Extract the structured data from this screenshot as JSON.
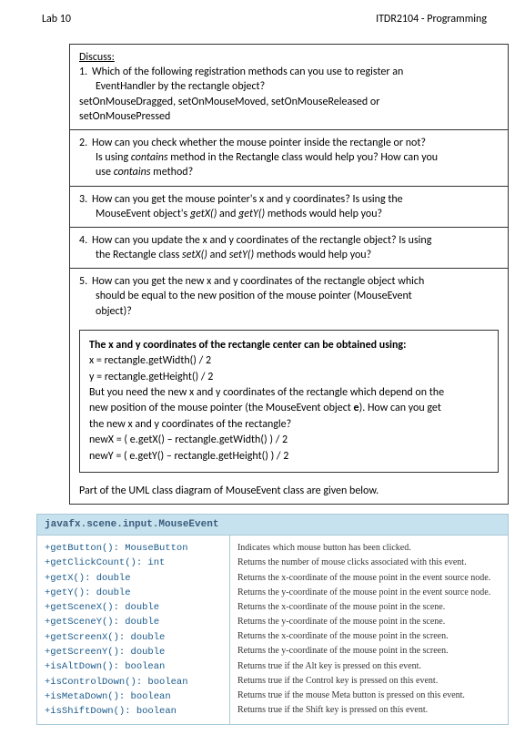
{
  "header": {
    "left": "Lab 10",
    "right": "ITDR2104 - Programming"
  },
  "discuss_title": "Discuss:",
  "q1": {
    "num": "1.",
    "line1": "Which of the following registration methods can you use to register an",
    "line2": "EventHandler by the rectangle object?",
    "mono1": "setOnMouseDragged, setOnMouseMoved, setOnMouseReleased or",
    "mono2": "setOnMousePressed"
  },
  "q2": {
    "num": "2.",
    "line1": "How can you check whether the mouse pointer inside the rectangle or not?",
    "line2_a": "Is using ",
    "line2_i": "contains",
    "line2_b": " method in the Rectangle class would help you? How can you",
    "line3_a": "use ",
    "line3_i": "contains",
    "line3_b": " method?"
  },
  "q3": {
    "num": "3.",
    "line1": "How can you get the mouse pointer's x and y coordinates? Is using the",
    "line2_a": "MouseEvent object's ",
    "line2_i1": "getX()",
    "line2_b": " and ",
    "line2_i2": "getY()",
    "line2_c": " methods would help you?"
  },
  "q4": {
    "num": "4.",
    "line1": "How can you update the x and y coordinates of the rectangle object? Is using",
    "line2_a": "the Rectangle class ",
    "line2_i1": "setX()",
    "line2_b": " and ",
    "line2_i2": "setY()",
    "line2_c": " methods would help you?"
  },
  "q5": {
    "num": "5.",
    "line1": "How can you get the new x and y coordinates of the rectangle object which",
    "line2": "should be equal to the new position of the mouse pointer (MouseEvent",
    "line3": "object)?"
  },
  "box": {
    "b1": "The x and y coordinates of the rectangle center can be obtained using:",
    "l1": "x = rectangle.getWidth() / 2",
    "l2": "y = rectangle.getHeight() / 2",
    "l3": "But you need the new x and y coordinates of the rectangle which depend on the",
    "l4_a": "new position of the mouse pointer (the MouseEvent object ",
    "l4_b": "e",
    "l4_c": "). How can you get",
    "l5": "the new x and y coordinates of the rectangle?",
    "l6": "newX = ( e.getX() – rectangle.getWidth() ) / 2",
    "l7": "newY = ( e.getY() – rectangle.getHeight() ) / 2"
  },
  "uml_caption": "Part of the UML class diagram of MouseEvent class are given below.",
  "uml_title": "javafx.scene.input.MouseEvent",
  "uml_methods": [
    "+getButton(): MouseButton",
    "+getClickCount(): int",
    "+getX(): double",
    "+getY(): double",
    "+getSceneX(): double",
    "+getSceneY(): double",
    "+getScreenX(): double",
    "+getScreenY(): double",
    "+isAltDown(): boolean",
    "+isControlDown(): boolean",
    "+isMetaDown(): boolean",
    "+isShiftDown(): boolean"
  ],
  "uml_desc": [
    "Indicates which mouse button has been clicked.",
    "Returns the number of mouse clicks associated with this event.",
    "Returns the x-coordinate of the mouse point in the event source node.",
    "Returns the y-coordinate of the mouse point in the event source node.",
    "Returns the x-coordinate of the mouse point in the scene.",
    "Returns the y-coordinate of the mouse point in the scene.",
    "Returns the x-coordinate of the mouse point in the screen.",
    "Returns the y-coordinate of the mouse point in the screen.",
    "Returns true if the Alt key is pressed on this event.",
    "Returns true if the Control key is pressed on this event.",
    "Returns true if the mouse Meta button is pressed on this event.",
    "Returns true if the Shift key is pressed on this event."
  ]
}
